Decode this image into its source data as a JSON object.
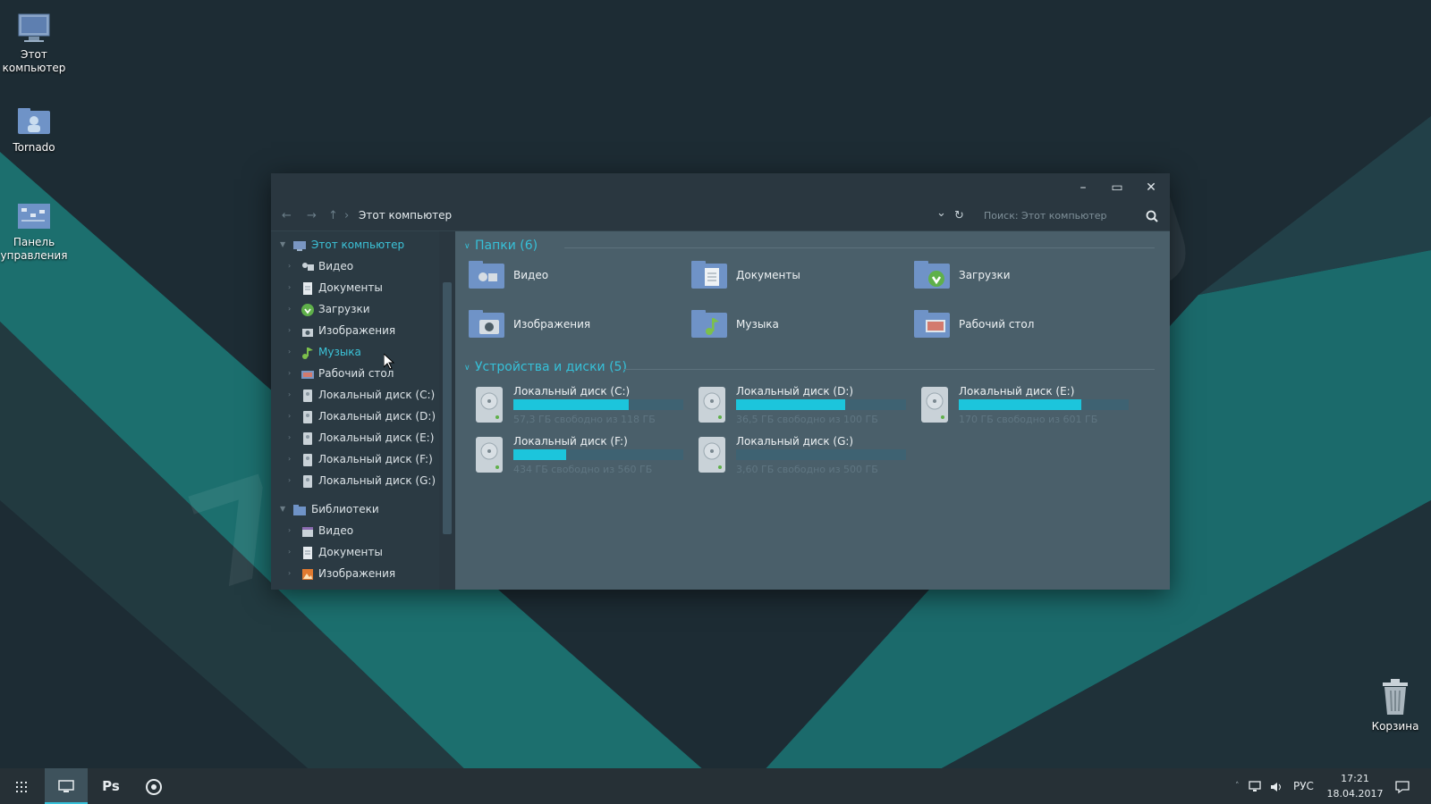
{
  "colors": {
    "accent": "#36c0d8",
    "bar_fill": "#1cc5dc",
    "window_bg": "#4a5f6a",
    "sidebar_bg": "#2b3a43"
  },
  "desktop": {
    "icons": [
      {
        "label": "Этот компьютер",
        "icon": "monitor-icon"
      },
      {
        "label": "Tornado",
        "icon": "user-folder-icon"
      },
      {
        "label": "Панель управления",
        "icon": "control-panel-icon"
      }
    ],
    "recycle_bin": {
      "label": "Корзина",
      "icon": "trash-icon"
    },
    "watermark": "7THEMES.SU"
  },
  "window": {
    "controls": {
      "minimize": "–",
      "maximize": "▭",
      "close": "✕"
    },
    "address": {
      "back": "←",
      "forward": "→",
      "up": "↑",
      "separator": "›",
      "crumb": "Этот компьютер",
      "dropdown": "⌄",
      "refresh": "↻",
      "search_placeholder": "Поиск: Этот компьютер"
    },
    "sidebar": {
      "root_pc": "Этот компьютер",
      "pc_items": [
        "Видео",
        "Документы",
        "Загрузки",
        "Изображения",
        "Музыка",
        "Рабочий стол",
        "Локальный диск (C:)",
        "Локальный диск (D:)",
        "Локальный диск (E:)",
        "Локальный диск (F:)",
        "Локальный диск (G:)"
      ],
      "active_item": "Музыка",
      "root_libraries": "Библиотеки",
      "library_items": [
        "Видео",
        "Документы",
        "Изображения"
      ]
    },
    "content": {
      "folders_title": "Папки (6)",
      "folders": [
        "Видео",
        "Документы",
        "Загрузки",
        "Изображения",
        "Музыка",
        "Рабочий стол"
      ],
      "drives_title": "Устройства и диски (5)",
      "drives": [
        {
          "name": "Локальный диск (C:)",
          "info": "57,3 ГБ свободно из 118 ГБ",
          "used_fraction": 0.68
        },
        {
          "name": "Локальный диск (D:)",
          "info": "36,5 ГБ свободно из 100 ГБ",
          "used_fraction": 0.64
        },
        {
          "name": "Локальный диск (E:)",
          "info": "170 ГБ свободно из 601 ГБ",
          "used_fraction": 0.72
        },
        {
          "name": "Локальный диск (F:)",
          "info": "434 ГБ свободно из 560 ГБ",
          "used_fraction": 0.31
        },
        {
          "name": "Локальный диск (G:)",
          "info": "3,60 ГБ свободно из 500 ГБ",
          "used_fraction": 0.0
        }
      ]
    }
  },
  "taskbar": {
    "apps": [
      "apps-grid-icon",
      "explorer-icon",
      "photoshop-icon",
      "chrome-icon"
    ],
    "ps_label": "Ps",
    "lang": "РУС",
    "time": "17:21",
    "date": "18.04.2017"
  }
}
